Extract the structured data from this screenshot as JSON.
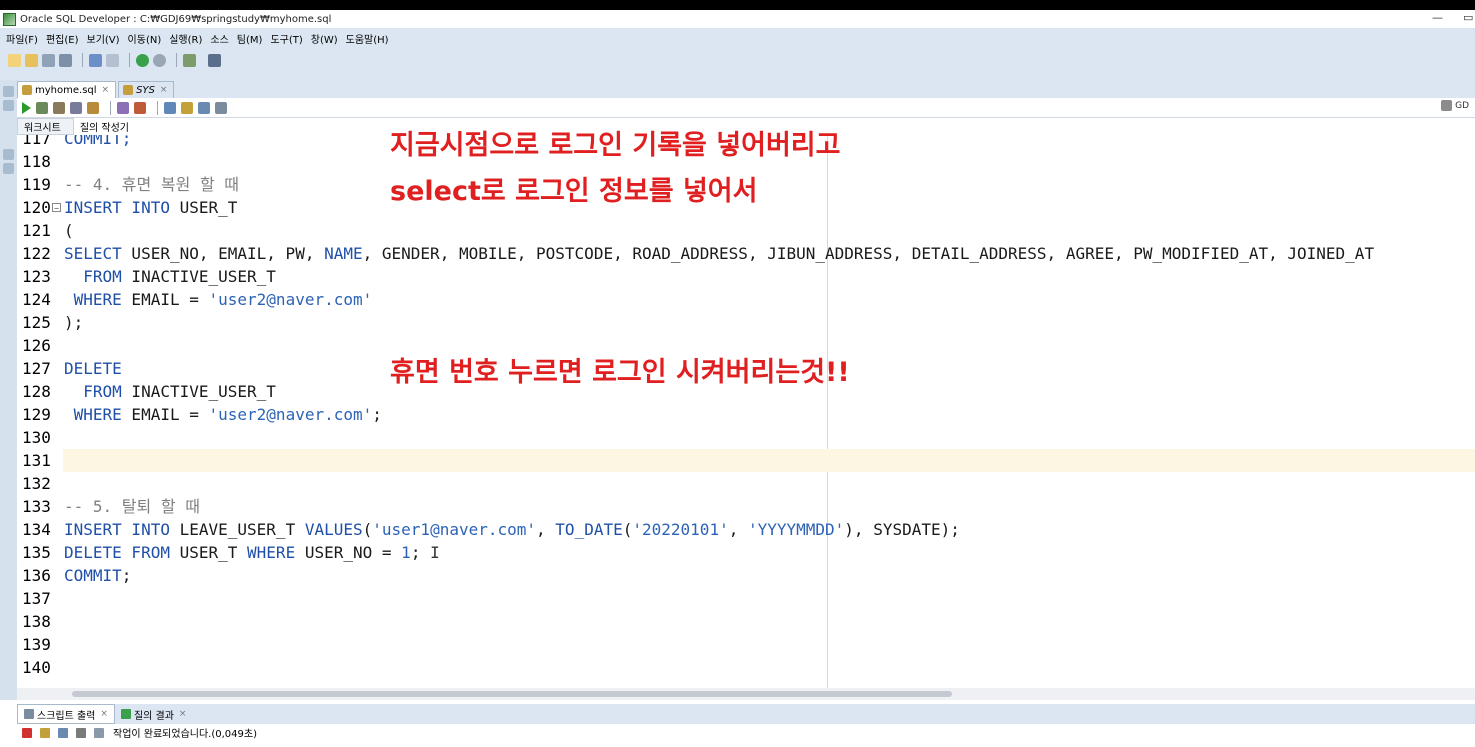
{
  "window": {
    "title": "Oracle SQL Developer : C:₩GDJ69₩springstudy₩myhome.sql",
    "minimize": "—",
    "restore": "▭"
  },
  "menu": [
    "파일(F)",
    "편집(E)",
    "보기(V)",
    "이동(N)",
    "실행(R)",
    "소스",
    "팀(M)",
    "도구(T)",
    "창(W)",
    "도움말(H)"
  ],
  "doc_tabs": [
    {
      "label": "myhome.sql",
      "active": true
    },
    {
      "label": "SYS",
      "active": false
    }
  ],
  "connection": "GD",
  "sub_tabs": [
    "워크시트",
    "질의 작성기"
  ],
  "editor": {
    "lines": [
      {
        "n": "117",
        "tokens": [
          {
            "t": "COMMIT;",
            "c": "kw"
          }
        ]
      },
      {
        "n": "118",
        "tokens": []
      },
      {
        "n": "119",
        "tokens": [
          {
            "t": "-- 4. 휴면 복원 할 때",
            "c": "cm"
          }
        ]
      },
      {
        "n": "120",
        "fold": true,
        "tokens": [
          {
            "t": "INSERT INTO",
            "c": "kw"
          },
          {
            "t": " USER_T",
            "c": ""
          }
        ]
      },
      {
        "n": "121",
        "tokens": [
          {
            "t": "(",
            "c": ""
          }
        ]
      },
      {
        "n": "122",
        "tokens": [
          {
            "t": "SELECT",
            "c": "kw"
          },
          {
            "t": " USER_NO, EMAIL, PW, ",
            "c": ""
          },
          {
            "t": "NAME",
            "c": "kw"
          },
          {
            "t": ", GENDER, MOBILE, POSTCODE, ROAD_ADDRESS, JIBUN_ADDRESS, DETAIL_ADDRESS, AGREE, PW_MODIFIED_AT, JOINED_AT",
            "c": ""
          }
        ]
      },
      {
        "n": "123",
        "tokens": [
          {
            "t": "  FROM",
            "c": "kw"
          },
          {
            "t": " INACTIVE_USER_T",
            "c": ""
          }
        ]
      },
      {
        "n": "124",
        "tokens": [
          {
            "t": " WHERE",
            "c": "kw"
          },
          {
            "t": " EMAIL = ",
            "c": ""
          },
          {
            "t": "'user2@naver.com'",
            "c": "str"
          }
        ]
      },
      {
        "n": "125",
        "tokens": [
          {
            "t": ");",
            "c": ""
          }
        ]
      },
      {
        "n": "126",
        "tokens": []
      },
      {
        "n": "127",
        "tokens": [
          {
            "t": "DELETE",
            "c": "kw"
          }
        ]
      },
      {
        "n": "128",
        "tokens": [
          {
            "t": "  FROM",
            "c": "kw"
          },
          {
            "t": " INACTIVE_USER_T",
            "c": ""
          }
        ]
      },
      {
        "n": "129",
        "tokens": [
          {
            "t": " WHERE",
            "c": "kw"
          },
          {
            "t": " EMAIL = ",
            "c": ""
          },
          {
            "t": "'user2@naver.com'",
            "c": "str"
          },
          {
            "t": ";",
            "c": ""
          }
        ]
      },
      {
        "n": "130",
        "tokens": []
      },
      {
        "n": "131",
        "current": true,
        "tokens": []
      },
      {
        "n": "132",
        "tokens": []
      },
      {
        "n": "133",
        "tokens": [
          {
            "t": "-- 5. 탈퇴 할 때",
            "c": "cm"
          }
        ]
      },
      {
        "n": "134",
        "tokens": [
          {
            "t": "INSERT INTO",
            "c": "kw"
          },
          {
            "t": " LEAVE_USER_T ",
            "c": ""
          },
          {
            "t": "VALUES",
            "c": "kw"
          },
          {
            "t": "(",
            "c": ""
          },
          {
            "t": "'user1@naver.com'",
            "c": "str"
          },
          {
            "t": ", ",
            "c": ""
          },
          {
            "t": "TO_DATE",
            "c": "kw"
          },
          {
            "t": "(",
            "c": ""
          },
          {
            "t": "'20220101'",
            "c": "str"
          },
          {
            "t": ", ",
            "c": ""
          },
          {
            "t": "'YYYYMMDD'",
            "c": "str"
          },
          {
            "t": "), SYSDATE);",
            "c": ""
          }
        ]
      },
      {
        "n": "135",
        "tokens": [
          {
            "t": "DELETE FROM",
            "c": "kw"
          },
          {
            "t": " USER_T ",
            "c": ""
          },
          {
            "t": "WHERE",
            "c": "kw"
          },
          {
            "t": " USER_NO = ",
            "c": ""
          },
          {
            "t": "1",
            "c": "str"
          },
          {
            "t": "; ",
            "c": ""
          },
          {
            "t": "I",
            "c": "caret"
          }
        ]
      },
      {
        "n": "136",
        "tokens": [
          {
            "t": "COMMIT",
            "c": "kw"
          },
          {
            "t": ";",
            "c": ""
          }
        ]
      },
      {
        "n": "137",
        "tokens": []
      },
      {
        "n": "138",
        "tokens": []
      },
      {
        "n": "139",
        "tokens": []
      },
      {
        "n": "140",
        "tokens": []
      }
    ]
  },
  "annotations": {
    "line1": "지금시점으로 로그인 기록을 넣어버리고",
    "line2": "select로 로그인 정보를 넣어서",
    "line3": "휴면 번호 누르면 로그인 시켜버리는것!!"
  },
  "bottom_tabs": [
    {
      "label": "스크립트 출력",
      "active": true
    },
    {
      "label": "질의 결과",
      "active": false
    }
  ],
  "status": "작업이 완료되었습니다.(0,049초)",
  "colors": {
    "keyword": "#1f4fa8",
    "string": "#2d63b6",
    "comment": "#808080",
    "annotation": "#e02020"
  }
}
